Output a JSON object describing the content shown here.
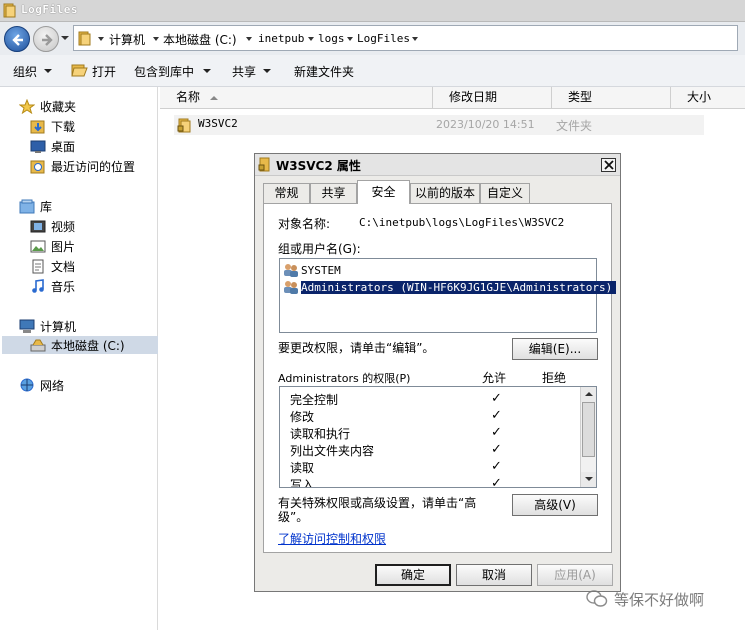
{
  "window": {
    "title": "LogFiles"
  },
  "address": {
    "crumbs": [
      "计算机",
      "本地磁盘 (C:)",
      "inetpub",
      "logs",
      "LogFiles"
    ]
  },
  "toolbar": {
    "organize": "组织",
    "open": "打开",
    "include_library": "包含到库中",
    "share": "共享",
    "new_folder": "新建文件夹"
  },
  "navpane": {
    "favorites": "收藏夹",
    "downloads": "下载",
    "desktop": "桌面",
    "recent": "最近访问的位置",
    "libraries": "库",
    "videos": "视频",
    "pictures": "图片",
    "documents": "文档",
    "music": "音乐",
    "computer": "计算机",
    "local_disk": "本地磁盘 (C:)",
    "network": "网络"
  },
  "columns": {
    "name": "名称",
    "modified": "修改日期",
    "type": "类型",
    "size": "大小"
  },
  "files": [
    {
      "name": "W3SVC2",
      "modified": "2023/10/20 14:51",
      "type": "文件夹"
    }
  ],
  "dialog": {
    "title": "W3SVC2 属性",
    "tabs": [
      "常规",
      "共享",
      "安全",
      "以前的版本",
      "自定义"
    ],
    "active_tab": "安全",
    "object_name_label": "对象名称:",
    "object_name_value": "C:\\inetpub\\logs\\LogFiles\\W3SVC2",
    "group_label": "组或用户名(G):",
    "users": [
      {
        "name": "SYSTEM",
        "selected": false
      },
      {
        "name": "Administrators (WIN-HF6K9JG1GJE\\Administrators)",
        "selected": true
      }
    ],
    "change_perm_text": "要更改权限，请单击“编辑”。",
    "edit_button": "编辑(E)...",
    "perm_label": "Administrators 的权限(P)",
    "allow_header": "允许",
    "deny_header": "拒绝",
    "check_mark": "✓",
    "permissions": [
      {
        "name": "完全控制",
        "allow": true
      },
      {
        "name": "修改",
        "allow": true
      },
      {
        "name": "读取和执行",
        "allow": true
      },
      {
        "name": "列出文件夹内容",
        "allow": true
      },
      {
        "name": "读取",
        "allow": true
      },
      {
        "name": "写入",
        "allow": true
      }
    ],
    "advanced_text_line1": "有关特殊权限或高级设置，请单击“高",
    "advanced_text_line2": "级”。",
    "advanced_button": "高级(V)",
    "link_text": "了解访问控制和权限",
    "ok_button": "确定",
    "cancel_button": "取消",
    "apply_button": "应用(A)"
  },
  "watermark": {
    "text": "等保不好做啊"
  },
  "colors": {
    "selection": "#0a246a",
    "link": "#0033cc",
    "folder": "#e8b94a"
  }
}
